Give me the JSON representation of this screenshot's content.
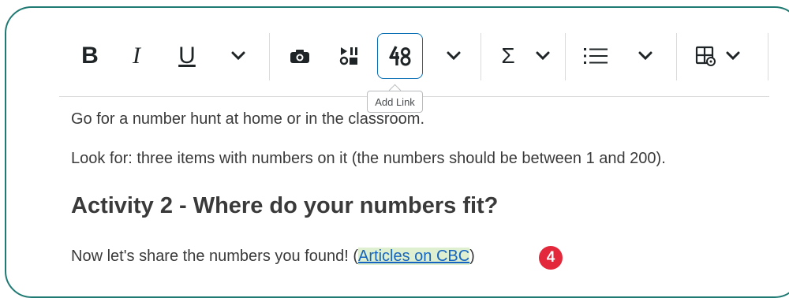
{
  "toolbar": {
    "bold_label": "B",
    "italic_label": "I",
    "underline_label": "U",
    "sigma_label": "Σ",
    "tooltip": "Add Link"
  },
  "content": {
    "line1": "Go for a number hunt at home or in the classroom.",
    "line2": "Look for: three items with numbers on it (the numbers should be between 1 and 200).",
    "heading": "Activity 2 - Where do your numbers fit?",
    "line3_prefix": "Now let's share the numbers you found! (",
    "link_text": "Articles on CBC",
    "line3_suffix": ")",
    "badge": "4"
  },
  "colors": {
    "frame": "#1f7a73",
    "active_border": "#0a6fb5",
    "link": "#1565c0",
    "link_highlight": "#dff0d0",
    "badge": "#e2283a"
  },
  "icons": [
    "camera-icon",
    "media-icon",
    "add-link-icon",
    "list-icon",
    "table-icon",
    "chevron-down-icon"
  ]
}
